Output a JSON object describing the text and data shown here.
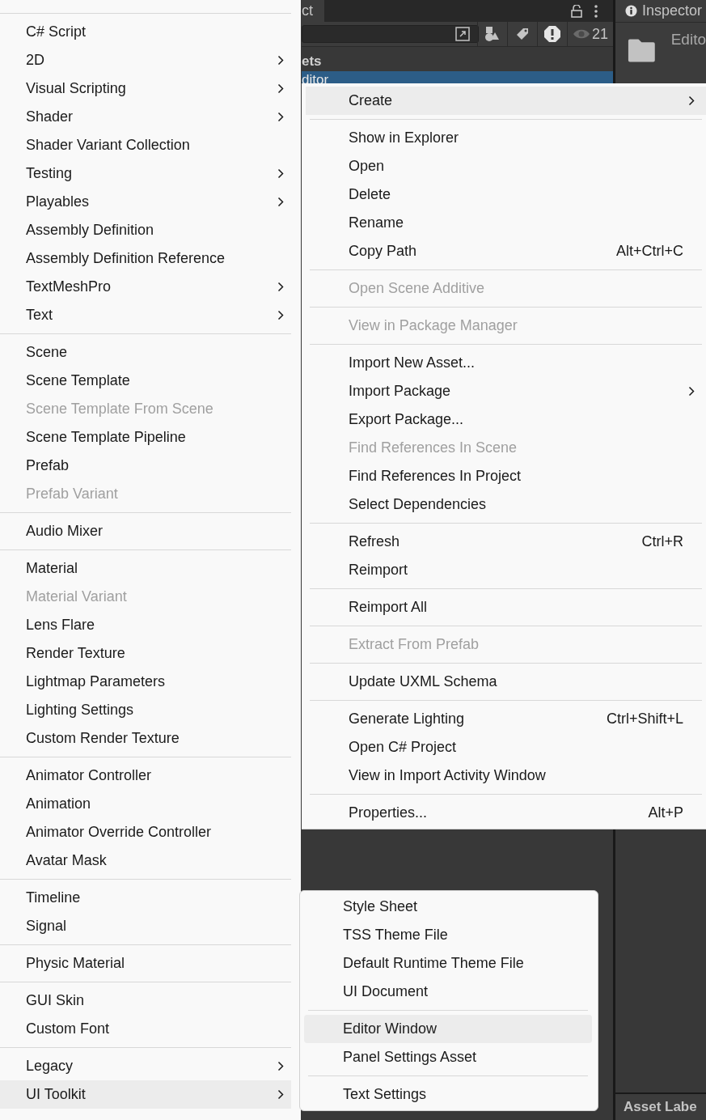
{
  "editor": {
    "project_tab": "ct",
    "hidden_count": "21",
    "breadcrumb": "ets",
    "selected_asset": "ditor",
    "inspector_tab": "Inspector",
    "inspector_title": "Edito",
    "asset_labels": "Asset Labe"
  },
  "create_menu": {
    "groups": [
      {
        "items": [
          {
            "label": "C# Script",
            "submenu": false,
            "disabled": false,
            "selected": false
          },
          {
            "label": "2D",
            "submenu": true,
            "disabled": false,
            "selected": false
          },
          {
            "label": "Visual Scripting",
            "submenu": true,
            "disabled": false,
            "selected": false
          },
          {
            "label": "Shader",
            "submenu": true,
            "disabled": false,
            "selected": false
          },
          {
            "label": "Shader Variant Collection",
            "submenu": false,
            "disabled": false,
            "selected": false
          },
          {
            "label": "Testing",
            "submenu": true,
            "disabled": false,
            "selected": false
          },
          {
            "label": "Playables",
            "submenu": true,
            "disabled": false,
            "selected": false
          },
          {
            "label": "Assembly Definition",
            "submenu": false,
            "disabled": false,
            "selected": false
          },
          {
            "label": "Assembly Definition Reference",
            "submenu": false,
            "disabled": false,
            "selected": false
          },
          {
            "label": "TextMeshPro",
            "submenu": true,
            "disabled": false,
            "selected": false
          },
          {
            "label": "Text",
            "submenu": true,
            "disabled": false,
            "selected": false
          }
        ]
      },
      {
        "items": [
          {
            "label": "Scene",
            "submenu": false,
            "disabled": false,
            "selected": false
          },
          {
            "label": "Scene Template",
            "submenu": false,
            "disabled": false,
            "selected": false
          },
          {
            "label": "Scene Template From Scene",
            "submenu": false,
            "disabled": true,
            "selected": false
          },
          {
            "label": "Scene Template Pipeline",
            "submenu": false,
            "disabled": false,
            "selected": false
          },
          {
            "label": "Prefab",
            "submenu": false,
            "disabled": false,
            "selected": false
          },
          {
            "label": "Prefab Variant",
            "submenu": false,
            "disabled": true,
            "selected": false
          }
        ]
      },
      {
        "items": [
          {
            "label": "Audio Mixer",
            "submenu": false,
            "disabled": false,
            "selected": false
          }
        ]
      },
      {
        "items": [
          {
            "label": "Material",
            "submenu": false,
            "disabled": false,
            "selected": false
          },
          {
            "label": "Material Variant",
            "submenu": false,
            "disabled": true,
            "selected": false
          },
          {
            "label": "Lens Flare",
            "submenu": false,
            "disabled": false,
            "selected": false
          },
          {
            "label": "Render Texture",
            "submenu": false,
            "disabled": false,
            "selected": false
          },
          {
            "label": "Lightmap Parameters",
            "submenu": false,
            "disabled": false,
            "selected": false
          },
          {
            "label": "Lighting Settings",
            "submenu": false,
            "disabled": false,
            "selected": false
          },
          {
            "label": "Custom Render Texture",
            "submenu": false,
            "disabled": false,
            "selected": false
          }
        ]
      },
      {
        "items": [
          {
            "label": "Animator Controller",
            "submenu": false,
            "disabled": false,
            "selected": false
          },
          {
            "label": "Animation",
            "submenu": false,
            "disabled": false,
            "selected": false
          },
          {
            "label": "Animator Override Controller",
            "submenu": false,
            "disabled": false,
            "selected": false
          },
          {
            "label": "Avatar Mask",
            "submenu": false,
            "disabled": false,
            "selected": false
          }
        ]
      },
      {
        "items": [
          {
            "label": "Timeline",
            "submenu": false,
            "disabled": false,
            "selected": false
          },
          {
            "label": "Signal",
            "submenu": false,
            "disabled": false,
            "selected": false
          }
        ]
      },
      {
        "items": [
          {
            "label": "Physic Material",
            "submenu": false,
            "disabled": false,
            "selected": false
          }
        ]
      },
      {
        "items": [
          {
            "label": "GUI Skin",
            "submenu": false,
            "disabled": false,
            "selected": false
          },
          {
            "label": "Custom Font",
            "submenu": false,
            "disabled": false,
            "selected": false
          }
        ]
      },
      {
        "items": [
          {
            "label": "Legacy",
            "submenu": true,
            "disabled": false,
            "selected": false
          },
          {
            "label": "UI Toolkit",
            "submenu": true,
            "disabled": false,
            "selected": true
          }
        ]
      }
    ]
  },
  "context_menu": {
    "groups": [
      {
        "items": [
          {
            "label": "Create",
            "submenu": true,
            "disabled": false,
            "selected": true
          }
        ]
      },
      {
        "items": [
          {
            "label": "Show in Explorer",
            "submenu": false,
            "disabled": false,
            "selected": false
          },
          {
            "label": "Open",
            "submenu": false,
            "disabled": false,
            "selected": false
          },
          {
            "label": "Delete",
            "submenu": false,
            "disabled": false,
            "selected": false
          },
          {
            "label": "Rename",
            "submenu": false,
            "disabled": false,
            "selected": false
          },
          {
            "label": "Copy Path",
            "shortcut": "Alt+Ctrl+C",
            "submenu": false,
            "disabled": false,
            "selected": false
          }
        ]
      },
      {
        "items": [
          {
            "label": "Open Scene Additive",
            "submenu": false,
            "disabled": true,
            "selected": false
          }
        ]
      },
      {
        "items": [
          {
            "label": "View in Package Manager",
            "submenu": false,
            "disabled": true,
            "selected": false
          }
        ]
      },
      {
        "items": [
          {
            "label": "Import New Asset...",
            "submenu": false,
            "disabled": false,
            "selected": false
          },
          {
            "label": "Import Package",
            "submenu": true,
            "disabled": false,
            "selected": false
          },
          {
            "label": "Export Package...",
            "submenu": false,
            "disabled": false,
            "selected": false
          },
          {
            "label": "Find References In Scene",
            "submenu": false,
            "disabled": true,
            "selected": false
          },
          {
            "label": "Find References In Project",
            "submenu": false,
            "disabled": false,
            "selected": false
          },
          {
            "label": "Select Dependencies",
            "submenu": false,
            "disabled": false,
            "selected": false
          }
        ]
      },
      {
        "items": [
          {
            "label": "Refresh",
            "shortcut": "Ctrl+R",
            "submenu": false,
            "disabled": false,
            "selected": false
          },
          {
            "label": "Reimport",
            "submenu": false,
            "disabled": false,
            "selected": false
          }
        ]
      },
      {
        "items": [
          {
            "label": "Reimport All",
            "submenu": false,
            "disabled": false,
            "selected": false
          }
        ]
      },
      {
        "items": [
          {
            "label": "Extract From Prefab",
            "submenu": false,
            "disabled": true,
            "selected": false
          }
        ]
      },
      {
        "items": [
          {
            "label": "Update UXML Schema",
            "submenu": false,
            "disabled": false,
            "selected": false
          }
        ]
      },
      {
        "items": [
          {
            "label": "Generate Lighting",
            "shortcut": "Ctrl+Shift+L",
            "submenu": false,
            "disabled": false,
            "selected": false
          },
          {
            "label": "Open C# Project",
            "submenu": false,
            "disabled": false,
            "selected": false
          },
          {
            "label": "View in Import Activity Window",
            "submenu": false,
            "disabled": false,
            "selected": false
          }
        ]
      },
      {
        "items": [
          {
            "label": "Properties...",
            "shortcut": "Alt+P",
            "submenu": false,
            "disabled": false,
            "selected": false
          }
        ]
      }
    ]
  },
  "ui_toolkit_menu": {
    "groups": [
      {
        "items": [
          {
            "label": "Style Sheet",
            "submenu": false,
            "disabled": false,
            "selected": false
          },
          {
            "label": "TSS Theme File",
            "submenu": false,
            "disabled": false,
            "selected": false
          },
          {
            "label": "Default Runtime Theme File",
            "submenu": false,
            "disabled": false,
            "selected": false
          },
          {
            "label": "UI Document",
            "submenu": false,
            "disabled": false,
            "selected": false
          }
        ]
      },
      {
        "items": [
          {
            "label": "Editor Window",
            "submenu": false,
            "disabled": false,
            "selected": true
          },
          {
            "label": "Panel Settings Asset",
            "submenu": false,
            "disabled": false,
            "selected": false
          }
        ]
      },
      {
        "items": [
          {
            "label": "Text Settings",
            "submenu": false,
            "disabled": false,
            "selected": false
          }
        ]
      }
    ]
  }
}
